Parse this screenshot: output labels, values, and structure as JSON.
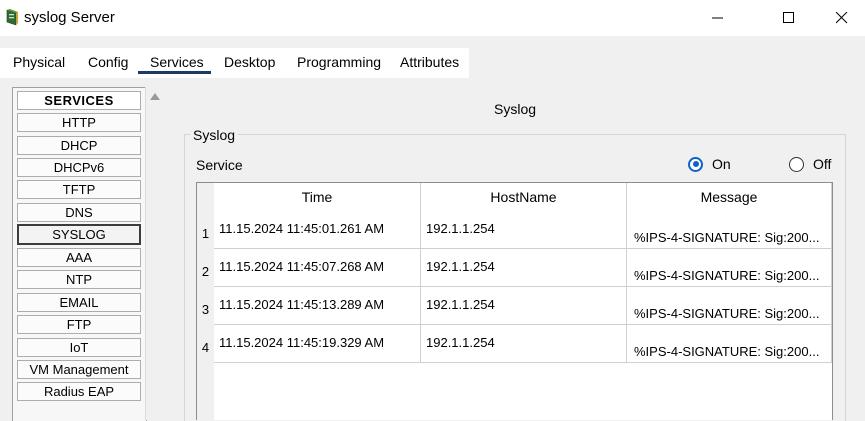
{
  "window": {
    "title": "syslog Server"
  },
  "tabs": [
    {
      "label": "Physical"
    },
    {
      "label": "Config"
    },
    {
      "label": "Services"
    },
    {
      "label": "Desktop"
    },
    {
      "label": "Programming"
    },
    {
      "label": "Attributes"
    }
  ],
  "active_tab": "Services",
  "services": {
    "header": "SERVICES",
    "items": [
      "HTTP",
      "DHCP",
      "DHCPv6",
      "TFTP",
      "DNS",
      "SYSLOG",
      "AAA",
      "NTP",
      "EMAIL",
      "FTP",
      "IoT",
      "VM Management",
      "Radius EAP"
    ],
    "selected": "SYSLOG"
  },
  "syslog": {
    "title": "Syslog",
    "group_label": "Syslog",
    "service_label": "Service",
    "on_label": "On",
    "off_label": "Off",
    "service_state": "On",
    "columns": [
      "Time",
      "HostName",
      "Message"
    ],
    "rows": [
      {
        "num": "1",
        "time": "11.15.2024 11:45:01.261 AM",
        "host": "192.1.1.254",
        "message": "%IPS-4-SIGNATURE: Sig:200..."
      },
      {
        "num": "2",
        "time": "11.15.2024 11:45:07.268 AM",
        "host": "192.1.1.254",
        "message": "%IPS-4-SIGNATURE: Sig:200..."
      },
      {
        "num": "3",
        "time": "11.15.2024 11:45:13.289 AM",
        "host": "192.1.1.254",
        "message": "%IPS-4-SIGNATURE: Sig:200..."
      },
      {
        "num": "4",
        "time": "11.15.2024 11:45:19.329 AM",
        "host": "192.1.1.254",
        "message": "%IPS-4-SIGNATURE: Sig:200..."
      }
    ]
  },
  "colors": {
    "accent": "#0f62c8",
    "tab_underline": "#1e3a64"
  }
}
